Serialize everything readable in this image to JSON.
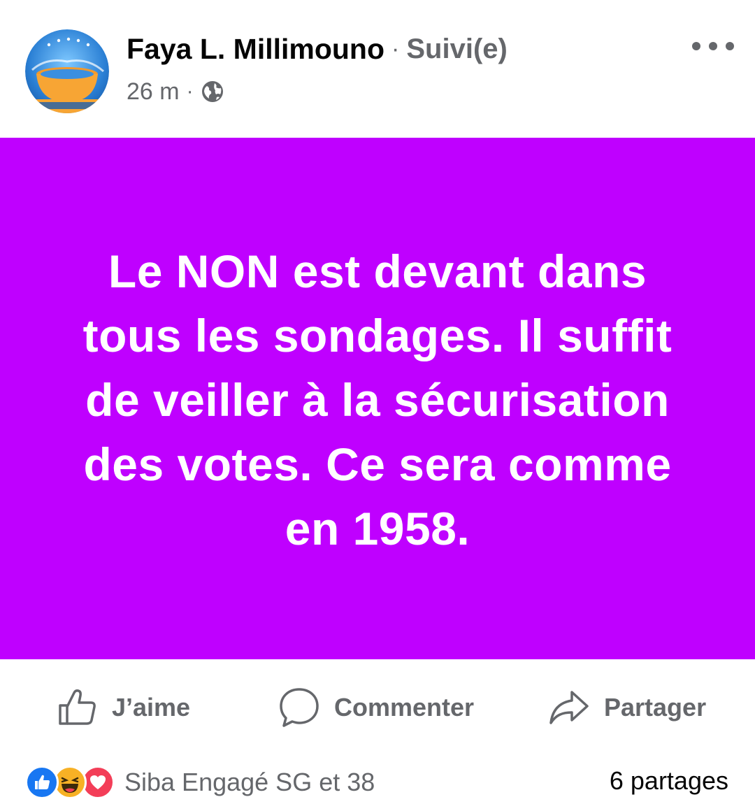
{
  "colors": {
    "post_background": "#bf00ff",
    "post_text": "#ffffff",
    "secondary_text": "#65676b",
    "primary_text": "#050505",
    "like_blue": "#1877f2",
    "love_red": "#f33e58",
    "haha_yellow": "#f7b125"
  },
  "header": {
    "avatar_icon": "page-avatar-icon",
    "author_name": "Faya L. Millimouno",
    "separator": "·",
    "follow_status": "Suivi(e)",
    "timestamp": "26 m",
    "meta_separator": "·",
    "audience_icon": "globe-icon",
    "more_icon": "more-horizontal-icon"
  },
  "post": {
    "text": "Le NON est devant dans tous les sondages. Il suffit de veiller à la sécurisation des votes. Ce sera comme en 1958."
  },
  "actions": {
    "like": {
      "label": "J’aime",
      "icon": "thumbs-up-icon"
    },
    "comment": {
      "label": "Commenter",
      "icon": "comment-bubble-icon"
    },
    "share": {
      "label": "Partager",
      "icon": "share-arrow-icon"
    }
  },
  "reactions": {
    "icons": [
      "like-reaction-icon",
      "haha-reaction-icon",
      "love-reaction-icon"
    ],
    "summary": "Siba Engagé SG et 38",
    "shares": "6 partages"
  }
}
